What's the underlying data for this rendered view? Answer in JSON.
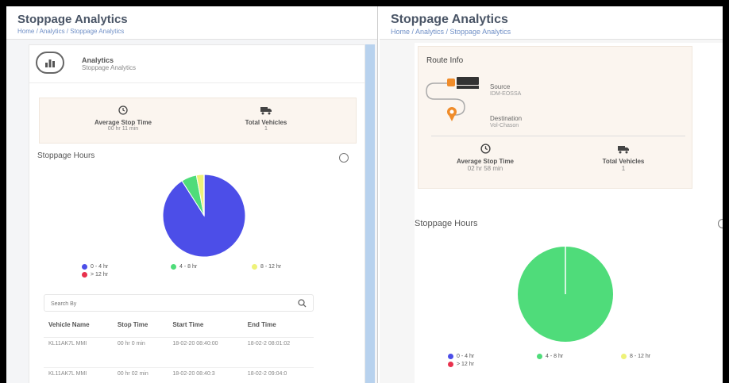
{
  "left": {
    "title": "Stoppage Analytics",
    "breadcrumb": "Home / Analytics / Stoppage Analytics",
    "card_title": "Analytics",
    "card_subtitle": "Stoppage Analytics",
    "avg_label": "Average Stop Time",
    "avg_value": "00 hr 11 min",
    "veh_label": "Total Vehicles",
    "veh_value": "1",
    "section": "Stoppage Hours",
    "legend": [
      "0 - 4 hr",
      "4 - 8 hr",
      "8 - 12 hr",
      "> 12 hr"
    ],
    "search_placeholder": "Search By",
    "table": {
      "headers": [
        "Vehicle Name",
        "Stop Time",
        "Start Time",
        "End Time"
      ],
      "rows": [
        [
          "KL11AK7L MMI",
          "00 hr 0 min",
          "18-02-20 08:40:00",
          "18-02-2 08:01:02"
        ],
        [
          "KL11AK7L MMI",
          "00 hr 02 min",
          "18-02-20 08:40:3",
          "18-02-2 09:04:0"
        ]
      ]
    }
  },
  "right": {
    "title": "Stoppage Analytics",
    "breadcrumb": "Home / Analytics / Stoppage Analytics",
    "route_title": "Route Info",
    "source_label": "Source",
    "source_value": "IDM-EOSSA",
    "dest_label": "Destination",
    "dest_value": "Vol-Chason",
    "avg_label": "Average Stop Time",
    "avg_value": "02 hr 58 min",
    "veh_label": "Total Vehicles",
    "veh_value": "1",
    "section": "Stoppage Hours",
    "legend": [
      "0 - 4 hr",
      "4 - 8 hr",
      "8 - 12 hr",
      "> 12 hr"
    ]
  },
  "colors": {
    "blue": "#4c4ee8",
    "green": "#4fdc7a",
    "yellow": "#eef279",
    "red": "#e8314d",
    "accent": "#f08c2a"
  },
  "chart_data": [
    {
      "type": "pie",
      "categories": [
        "0 - 4 hr",
        "4 - 8 hr",
        "8 - 12 hr",
        "> 12 hr"
      ],
      "values": [
        91,
        6,
        3,
        0
      ]
    },
    {
      "type": "pie",
      "categories": [
        "0 - 4 hr",
        "4 - 8 hr",
        "8 - 12 hr",
        "> 12 hr"
      ],
      "values": [
        0,
        100,
        0,
        0
      ]
    }
  ]
}
